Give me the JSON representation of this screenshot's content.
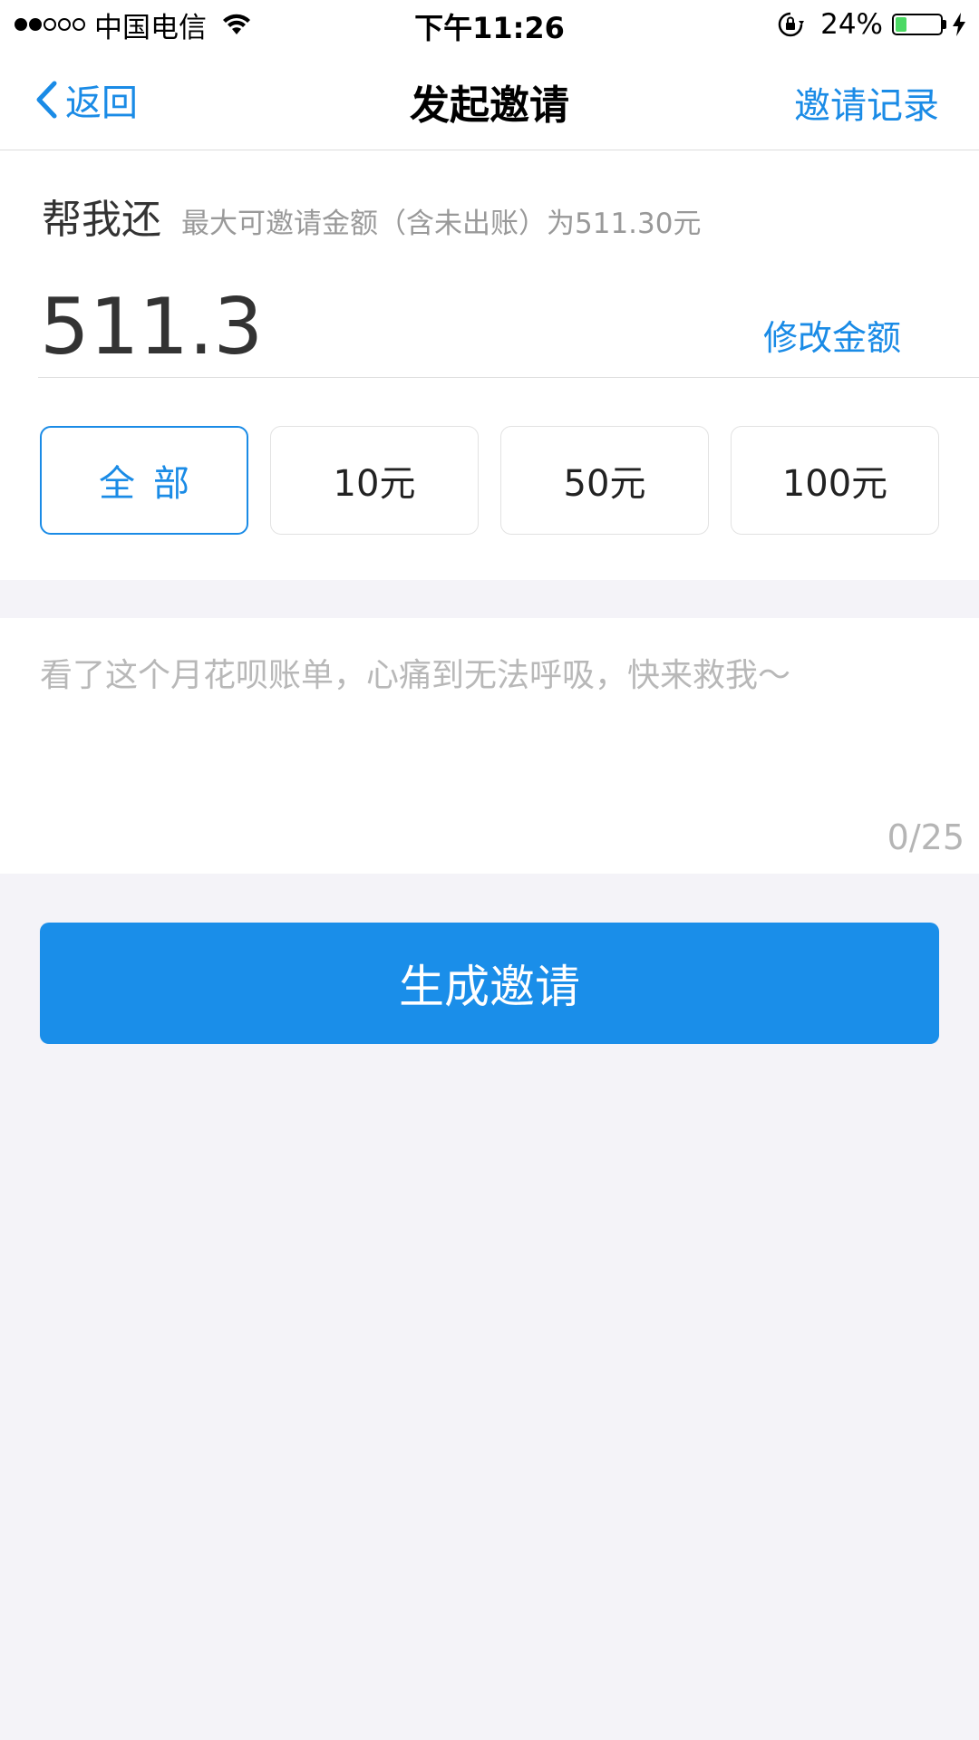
{
  "status_bar": {
    "carrier": "中国电信",
    "time": "下午11:26",
    "battery_percent": "24%",
    "battery_level": 0.24,
    "signal_bars_filled": 2,
    "signal_bars_total": 5
  },
  "nav": {
    "back_label": "返回",
    "title": "发起邀请",
    "right_label": "邀请记录"
  },
  "amount_section": {
    "title": "帮我还",
    "subtitle": "最大可邀请金额（含未出账）为511.30元",
    "amount": "511.3",
    "edit_label": "修改金额",
    "chips": [
      {
        "label": "全部",
        "selected": true
      },
      {
        "label": "10元",
        "selected": false
      },
      {
        "label": "50元",
        "selected": false
      },
      {
        "label": "100元",
        "selected": false
      }
    ]
  },
  "message": {
    "placeholder": "看了这个月花呗账单，心痛到无法呼吸，快来救我～",
    "count": "0/25"
  },
  "primary_button": {
    "label": "生成邀请"
  },
  "colors": {
    "accent": "#1a8be6",
    "button": "#1a8ee9",
    "background": "#f4f3f8",
    "battery": "#4cd964"
  },
  "icons": {
    "back": "chevron-left-icon",
    "wifi": "wifi-icon",
    "rotation_lock": "rotation-lock-icon",
    "battery": "battery-icon",
    "charging": "charging-bolt-icon"
  }
}
